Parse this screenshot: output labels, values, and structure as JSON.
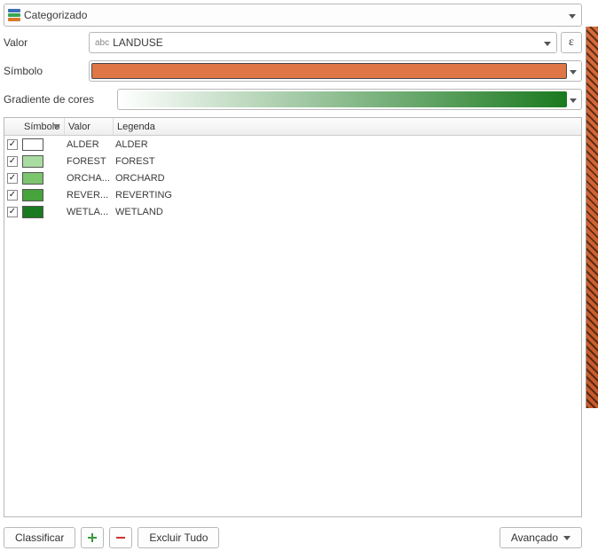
{
  "renderer": {
    "label": "Categorizado"
  },
  "labels": {
    "value": "Valor",
    "symbol": "Símbolo",
    "gradient": "Gradiente de cores"
  },
  "valueField": {
    "typeTag": "abc",
    "name": "LANDUSE"
  },
  "symbol": {
    "color": "#df7646",
    "border": "#4a4a4a"
  },
  "gradient": {
    "from": "#ffffff",
    "to": "#1a7a1f"
  },
  "columns": {
    "symbol": "Símbolo",
    "value": "Valor",
    "legend": "Legenda"
  },
  "categories": [
    {
      "checked": true,
      "color": "#ffffff",
      "value": "ALDER",
      "legend": "ALDER"
    },
    {
      "checked": true,
      "color": "#a9dca1",
      "value": "FOREST",
      "legend": "FOREST"
    },
    {
      "checked": true,
      "color": "#7cc46e",
      "value": "ORCHA...",
      "legend": "ORCHARD"
    },
    {
      "checked": true,
      "color": "#47a33b",
      "value": "REVER...",
      "legend": "REVERTING"
    },
    {
      "checked": true,
      "color": "#1a7a1f",
      "value": "WETLA...",
      "legend": "WETLAND"
    }
  ],
  "footer": {
    "classify": "Classificar",
    "deleteAll": "Excluir Tudo",
    "advanced": "Avançado"
  }
}
